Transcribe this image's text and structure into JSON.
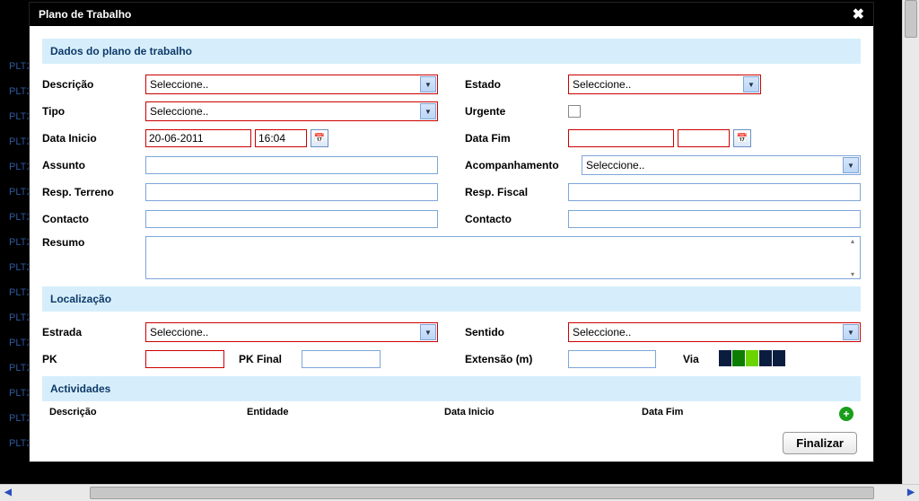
{
  "window": {
    "title": "Plano de Trabalho"
  },
  "sections": {
    "dados": {
      "title": "Dados do plano de trabalho"
    },
    "loc": {
      "title": "Localização"
    },
    "act": {
      "title": "Actividades"
    }
  },
  "labels": {
    "descricao": "Descrição",
    "estado": "Estado",
    "tipo": "Tipo",
    "urgente": "Urgente",
    "data_inicio": "Data Inicio",
    "data_fim": "Data Fim",
    "assunto": "Assunto",
    "acompanhamento": "Acompanhamento",
    "resp_terreno": "Resp. Terreno",
    "resp_fiscal": "Resp. Fiscal",
    "contacto": "Contacto",
    "resumo": "Resumo",
    "estrada": "Estrada",
    "sentido": "Sentido",
    "pk": "PK",
    "pk_final": "PK Final",
    "extensao": "Extensão (m)",
    "via": "Via"
  },
  "values": {
    "seleccione": "Seleccione..",
    "data_inicio_date": "20-06-2011",
    "data_inicio_time": "16:04",
    "data_fim_date": "",
    "data_fim_time": "",
    "assunto": "",
    "resp_terreno": "",
    "resp_fiscal": "",
    "contacto_left": "",
    "contacto_right": "",
    "resumo": "",
    "pk": "",
    "pk_final": "",
    "extensao": ""
  },
  "act_cols": {
    "descricao": "Descrição",
    "entidade": "Entidade",
    "data_inicio": "Data Inicio",
    "data_fim": "Data Fim"
  },
  "buttons": {
    "finalizar": "Finalizar"
  },
  "bg_row": "PLT2"
}
